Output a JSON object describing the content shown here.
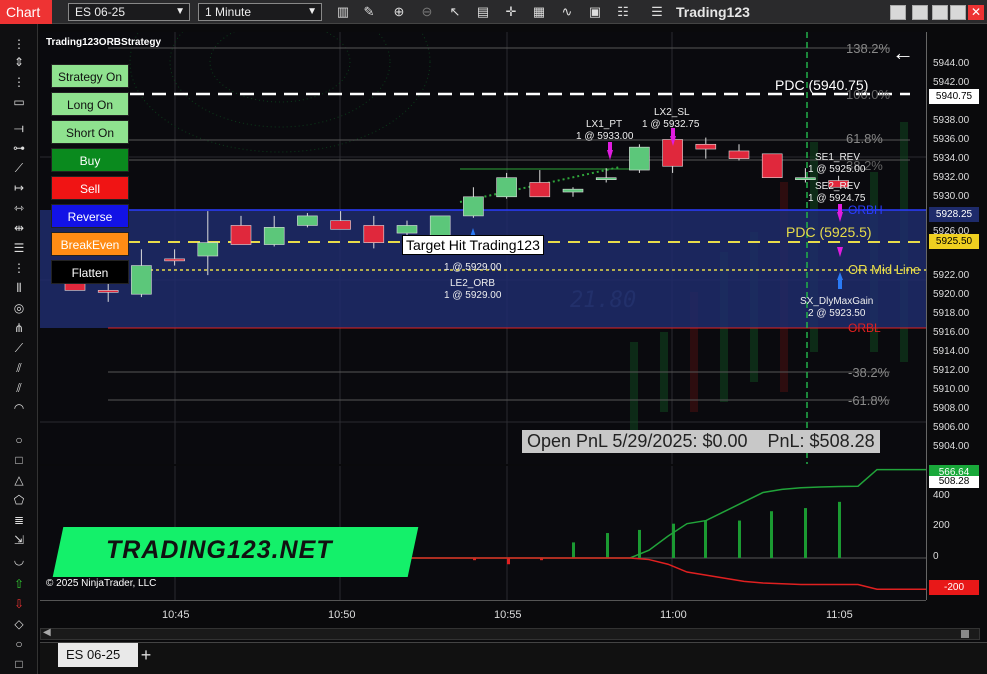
{
  "window": {
    "chart_tab": "Chart",
    "instrument": "ES 06-25",
    "interval": "1 Minute",
    "brand": "Trading123",
    "menu_icon": "hamburger-icon"
  },
  "chart": {
    "strategy_name": "Trading123ORBStrategy",
    "copyright": "© 2025 NinjaTrader, LLC",
    "watermark": "TRADING123.NET",
    "panel_badge": "F",
    "target_hit": "Target Hit Trading123",
    "pnl_text": "Open PnL 5/29/2025: $0.00    PnL: $508.28",
    "buttons": [
      {
        "label": "Strategy On",
        "bg": "#8fe28f",
        "fg": "#111"
      },
      {
        "label": "Long On",
        "bg": "#8fe28f",
        "fg": "#111"
      },
      {
        "label": "Short On",
        "bg": "#8fe28f",
        "fg": "#111"
      },
      {
        "label": "Buy",
        "bg": "#0a8a1e",
        "fg": "#fff"
      },
      {
        "label": "Sell",
        "bg": "#f01414",
        "fg": "#fff"
      },
      {
        "label": "Reverse",
        "bg": "#1212e6",
        "fg": "#fff"
      },
      {
        "label": "BreakEven",
        "bg": "#ff8c14",
        "fg": "#fff"
      },
      {
        "label": "Flatten",
        "bg": "#000000",
        "fg": "#fff"
      }
    ],
    "levels": {
      "pct_138": "138.2%",
      "pct_100": "100.0%",
      "pct_61": "61.8%",
      "pct_38_top": "38.2%",
      "pct_neg38": "-38.2%",
      "pct_neg61": "-61.8%",
      "pdc_high": "PDC (5940.75)",
      "pdc_mid": "PDC (5925.5)",
      "or_mid": "OR Mid Line",
      "orbh": "ORBH",
      "orbl": "ORBL"
    },
    "trades": {
      "lx1_name": "LX1_PT",
      "lx1_detail": "1 @ 5933.00",
      "lx2_name": "LX2_SL",
      "lx2_detail": "1 @ 5932.75",
      "se1_name": "SE1_REV",
      "se1_detail": "1 @ 5925.00",
      "se2_name": "SE2_REV",
      "se2_detail": "1 @ 5924.75",
      "le1_detail": "1 @ 5929.00",
      "le2_name": "LE2_ORB",
      "le2_detail": "1 @ 5929.00",
      "sx_name": "SX_DlyMaxGain",
      "sx_detail": "2 @ 5923.50"
    }
  },
  "price_axis": {
    "labels": [
      "5944.00",
      "5942.00",
      "5938.00",
      "5936.00",
      "5934.00",
      "5932.00",
      "5930.00",
      "5926.00",
      "5922.00",
      "5920.00",
      "5918.00",
      "5916.00",
      "5914.00",
      "5912.00",
      "5910.00",
      "5908.00",
      "5906.00",
      "5904.00"
    ],
    "box_pdc": "5940.75",
    "box_current": "5928.25",
    "box_mid": "5925.50"
  },
  "pnl_axis": {
    "labels": [
      "400",
      "200",
      "0"
    ],
    "box_top": "566.64",
    "box_second": "508.28",
    "box_neg": "-200"
  },
  "time_axis": [
    "10:45",
    "10:50",
    "10:55",
    "11:00",
    "11:05"
  ],
  "bottom_tab": "ES 06-25",
  "colors": {
    "accent": "#e33333",
    "orb_fill": "#1e2b6b",
    "up": "#5cc77a",
    "down": "#e0283c"
  },
  "chart_data": {
    "type": "candlestick",
    "x": [
      "10:42",
      "10:43",
      "10:44",
      "10:45",
      "10:46",
      "10:47",
      "10:48",
      "10:49",
      "10:50",
      "10:51",
      "10:52",
      "10:53",
      "10:54",
      "10:55",
      "10:56",
      "10:57",
      "10:58",
      "10:59",
      "11:00",
      "11:01",
      "11:02",
      "11:03",
      "11:04",
      "11:05"
    ],
    "open": [
      5919.2,
      5918.2,
      5917.8,
      5921.5,
      5921.8,
      5925.0,
      5923.0,
      5925.0,
      5925.5,
      5925.0,
      5924.2,
      5923.5,
      5926.0,
      5928.0,
      5929.5,
      5928.5,
      5930.0,
      5930.8,
      5934.0,
      5933.5,
      5932.8,
      5932.5,
      5930.0,
      5929.7
    ],
    "high": [
      5920.0,
      5919.0,
      5922.5,
      5922.5,
      5926.5,
      5926.0,
      5926.0,
      5926.3,
      5926.5,
      5926.0,
      5925.5,
      5925.3,
      5929.0,
      5930.5,
      5930.8,
      5929.0,
      5931.0,
      5933.5,
      5934.8,
      5934.2,
      5933.5,
      5932.5,
      5931.0,
      5930.2
    ],
    "low": [
      5918.2,
      5917.0,
      5917.5,
      5920.8,
      5919.8,
      5923.0,
      5922.8,
      5924.8,
      5925.0,
      5922.6,
      5923.0,
      5922.5,
      5925.8,
      5927.8,
      5928.0,
      5928.0,
      5929.5,
      5930.5,
      5930.5,
      5932.0,
      5931.8,
      5930.2,
      5929.5,
      5929.0
    ],
    "close": [
      5918.2,
      5918.0,
      5920.8,
      5921.3,
      5923.2,
      5923.0,
      5924.8,
      5926.0,
      5924.6,
      5923.2,
      5925.0,
      5926.0,
      5928.0,
      5930.0,
      5928.0,
      5928.8,
      5930.0,
      5933.2,
      5931.2,
      5933.0,
      5932.0,
      5930.0,
      5930.0,
      5929.0
    ],
    "ylim": [
      5903,
      5945
    ],
    "pnl": {
      "ylim": [
        -240,
        620
      ],
      "cumulative_top": [
        0,
        0,
        0,
        0,
        0,
        0,
        0,
        0,
        0,
        0,
        0,
        50,
        140,
        220,
        240,
        300,
        360,
        420,
        440,
        450,
        455,
        458,
        460,
        566.64
      ],
      "cumulative_bottom": [
        0,
        0,
        0,
        0,
        0,
        0,
        0,
        0,
        0,
        0,
        0,
        -10,
        -40,
        -90,
        -110,
        -130,
        -150,
        -160,
        -165,
        -170,
        -170,
        -170,
        -170,
        -200
      ]
    }
  }
}
